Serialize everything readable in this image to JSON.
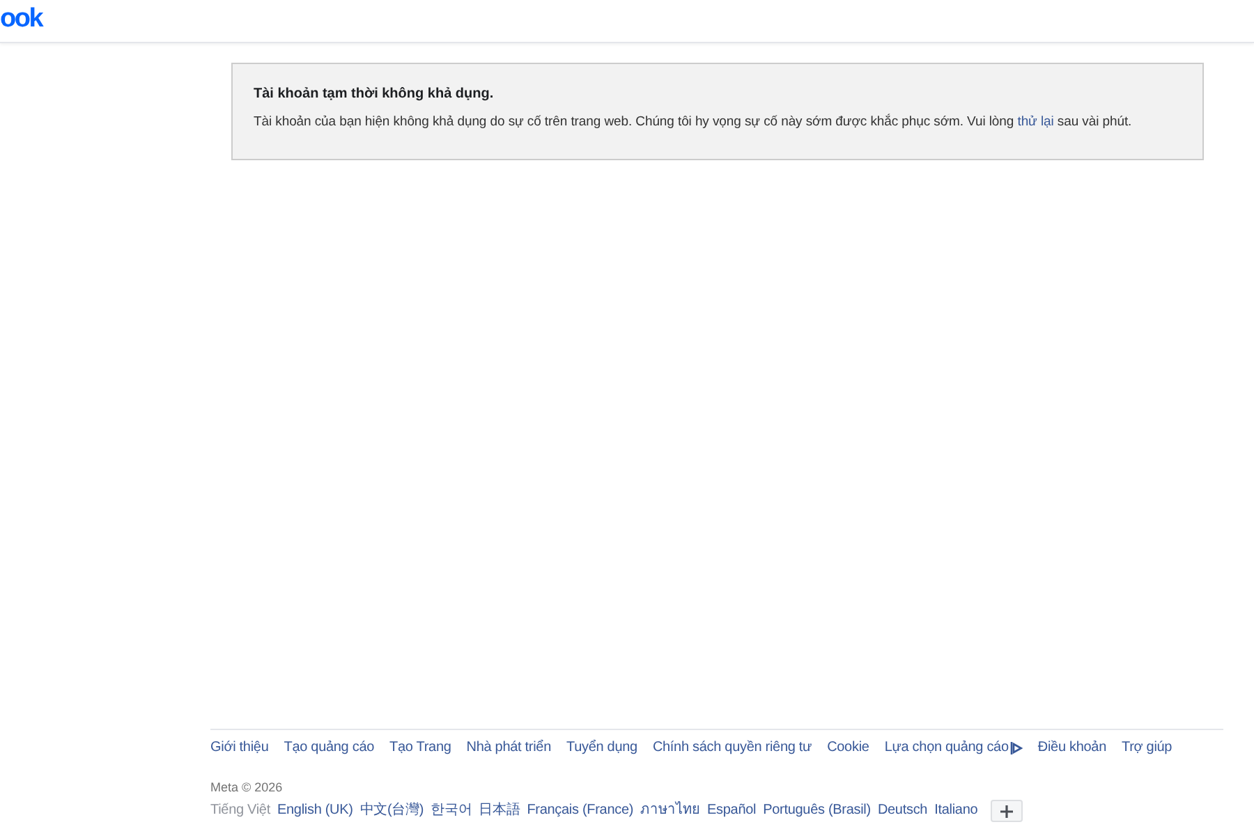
{
  "header": {
    "logo": "ook"
  },
  "notice": {
    "title": "Tài khoản tạm thời không khả dụng.",
    "message": {
      "before": "Tài khoản của bạn hiện không khả dụng do sự cố trên trang web. Chúng tôi hy vọng sự cố này sớm được khắc phục sớm. Vui lòng",
      "link": "thử lại",
      "after": "sau vài phút."
    }
  },
  "footer": {
    "links": [
      {
        "label": "Giới thiệu",
        "kind": "plain"
      },
      {
        "label": "Tạo quảng cáo",
        "kind": "plain"
      },
      {
        "label": "Tạo Trang",
        "kind": "plain"
      },
      {
        "label": "Nhà phát triển",
        "kind": "plain"
      },
      {
        "label": "Tuyển dụng",
        "kind": "plain"
      },
      {
        "label": "Chính sách quyền riêng tư",
        "kind": "plain"
      },
      {
        "label": "Cookie",
        "kind": "plain"
      },
      {
        "label": "Lựa chọn quảng cáo",
        "kind": "icon"
      },
      {
        "label": "Điều khoản",
        "kind": "plain"
      },
      {
        "label": "Trợ giúp",
        "kind": "plain"
      }
    ],
    "copyright": "Meta © 2026",
    "languages": [
      {
        "label": "Tiếng Việt",
        "selected": true
      },
      {
        "label": "English (UK)",
        "selected": false
      },
      {
        "label": "中文(台灣)",
        "selected": false
      },
      {
        "label": "한국어",
        "selected": false
      },
      {
        "label": "日本語",
        "selected": false
      },
      {
        "label": "Français (France)",
        "selected": false
      },
      {
        "label": "ภาษาไทย",
        "selected": false
      },
      {
        "label": "Español",
        "selected": false
      },
      {
        "label": "Português (Brasil)",
        "selected": false
      },
      {
        "label": "Deutsch",
        "selected": false
      },
      {
        "label": "Italiano",
        "selected": false
      }
    ]
  }
}
